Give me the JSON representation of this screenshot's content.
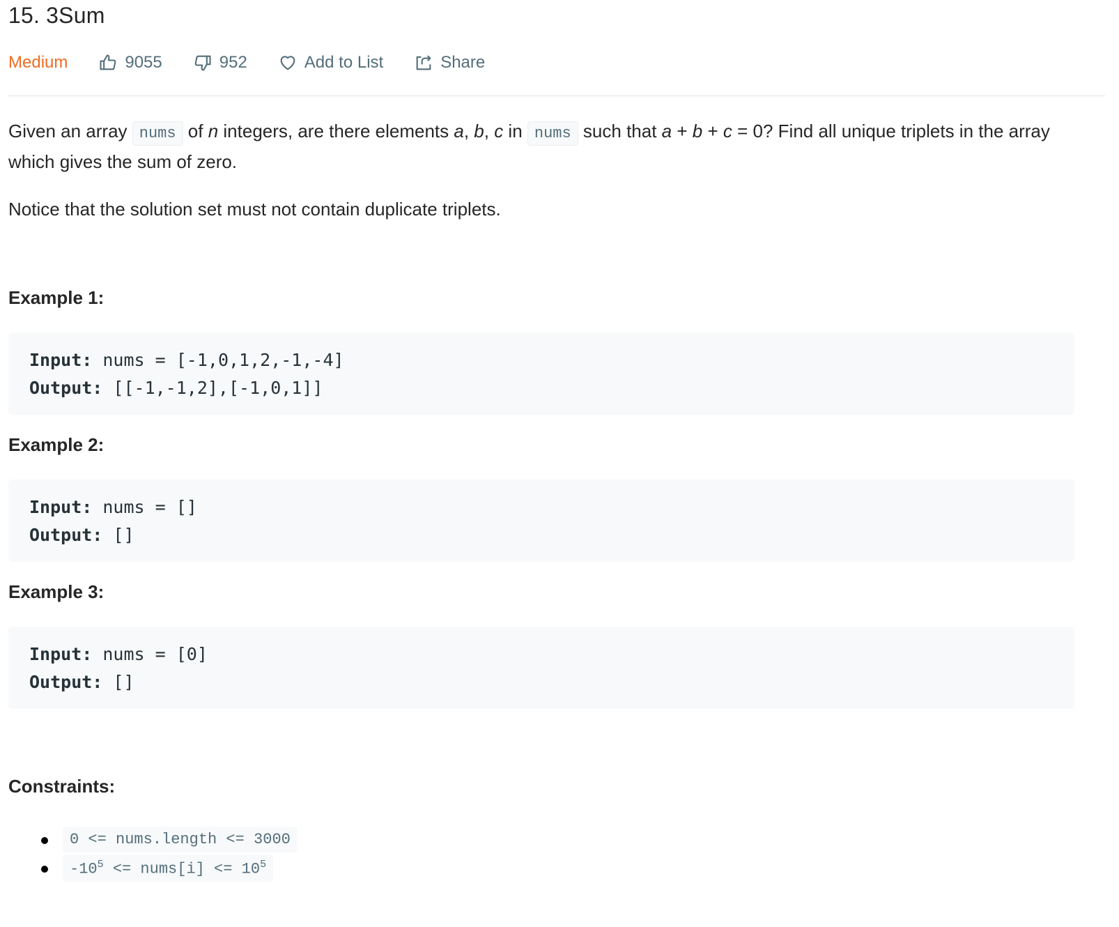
{
  "problem": {
    "title": "15. 3Sum",
    "difficulty": "Medium",
    "likes": "9055",
    "dislikes": "952",
    "add_to_list": "Add to List",
    "share": "Share"
  },
  "description": {
    "p1_a": "Given an array ",
    "code_nums": "nums",
    "p1_b": " of ",
    "n": "n",
    "p1_c": " integers, are there elements ",
    "a": "a",
    "comma1": ", ",
    "b": "b",
    "comma2": ", ",
    "c": "c",
    "p1_d": " in ",
    "p1_e": " such that ",
    "a2": "a",
    "plus1": " + ",
    "b2": "b",
    "plus2": " + ",
    "c2": "c",
    "p1_f": " = 0? Find all unique triplets in the array which gives the sum of zero.",
    "p2": "Notice that the solution set must not contain duplicate triplets."
  },
  "examples": [
    {
      "title": "Example 1:",
      "input_label": "Input:",
      "input": "nums = [-1,0,1,2,-1,-4]",
      "output_label": "Output:",
      "output": "[[-1,-1,2],[-1,0,1]]"
    },
    {
      "title": "Example 2:",
      "input_label": "Input:",
      "input": "nums = []",
      "output_label": "Output:",
      "output": "[]"
    },
    {
      "title": "Example 3:",
      "input_label": "Input:",
      "input": "nums = [0]",
      "output_label": "Output:",
      "output": "[]"
    }
  ],
  "constraints": {
    "title": "Constraints:",
    "c1": "0 <= nums.length <= 3000",
    "c2_a": "-10",
    "c2_exp1": "5",
    "c2_b": " <= nums[i] <= 10",
    "c2_exp2": "5"
  },
  "colors": {
    "difficulty": "#ef6c24",
    "meta": "#546e7a",
    "code_bg": "#f7f9fa"
  },
  "icons": [
    "thumbs-up-icon",
    "thumbs-down-icon",
    "heart-icon",
    "share-icon"
  ]
}
